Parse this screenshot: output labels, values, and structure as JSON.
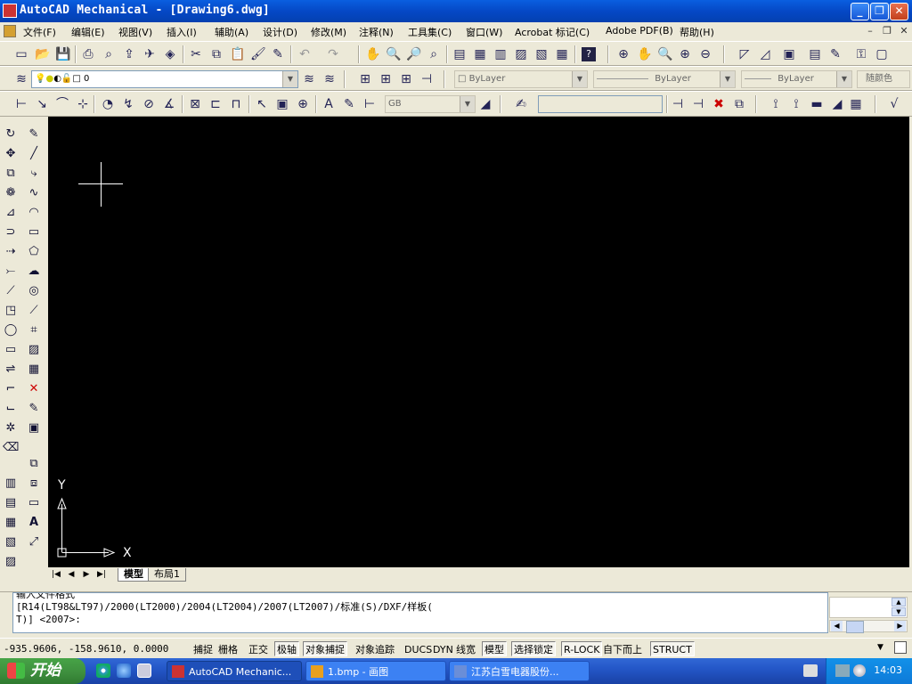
{
  "window": {
    "title": "AutoCAD Mechanical - [Drawing6.dwg]",
    "controls": {
      "minimize": "_",
      "restore": "❐",
      "close": "✕"
    }
  },
  "menu": {
    "items": [
      "文件(F)",
      "编辑(E)",
      "视图(V)",
      "插入(I)",
      "辅助(A)",
      "设计(D)",
      "修改(M)",
      "注释(N)",
      "工具集(C)",
      "窗口(W)",
      "Acrobat 标记(C)",
      "Adobe PDF(B)",
      "帮助(H)"
    ],
    "mdi_controls": {
      "minimize": "–",
      "restore": "❐",
      "close": "✕"
    }
  },
  "layers": {
    "current_layer": "0",
    "color": "ByLayer",
    "linetype": "ByLayer",
    "lineweight": "ByLayer",
    "plotstyle": "随颜色"
  },
  "dim_toolbar": {
    "standard": "GB",
    "input_value": ""
  },
  "ucs": {
    "x_label": "X",
    "y_label": "Y"
  },
  "layout_tabs": {
    "nav": [
      "|◀",
      "◀",
      "▶",
      "▶|"
    ],
    "tabs": [
      "模型",
      "布局1"
    ],
    "active": "模型"
  },
  "command_window": {
    "lines": [
      "输入文件格式",
      "[R14(LT98&LT97)/2000(LT2000)/2004(LT2004)/2007(LT2007)/标准(S)/DXF/样板(",
      "T)] <2007>:"
    ]
  },
  "status_bar": {
    "coords": "-935.9606, -158.9610, 0.0000",
    "toggles": [
      {
        "label": "捕捉",
        "on": false
      },
      {
        "label": "栅格",
        "on": false
      },
      {
        "label": "正交",
        "on": false
      },
      {
        "label": "极轴",
        "on": true
      },
      {
        "label": "对象捕捉",
        "on": true
      },
      {
        "label": "对象追踪",
        "on": false
      },
      {
        "label": "DUCS",
        "on": false
      },
      {
        "label": "DYN",
        "on": false
      },
      {
        "label": "线宽",
        "on": false
      },
      {
        "label": "模型",
        "on": true
      },
      {
        "label": "选择锁定",
        "on": true
      },
      {
        "label": "R-LOCK",
        "on": true
      },
      {
        "label": "自下而上",
        "on": false
      },
      {
        "label": "STRUCT",
        "on": true
      }
    ]
  },
  "taskbar": {
    "start_label": "开始",
    "tasks": [
      {
        "label": "AutoCAD Mechanic...",
        "active": true
      },
      {
        "label": "1.bmp - 画图",
        "active": false
      },
      {
        "label": "江苏白雪电器股份...",
        "active": false
      }
    ],
    "clock": "14:03"
  }
}
